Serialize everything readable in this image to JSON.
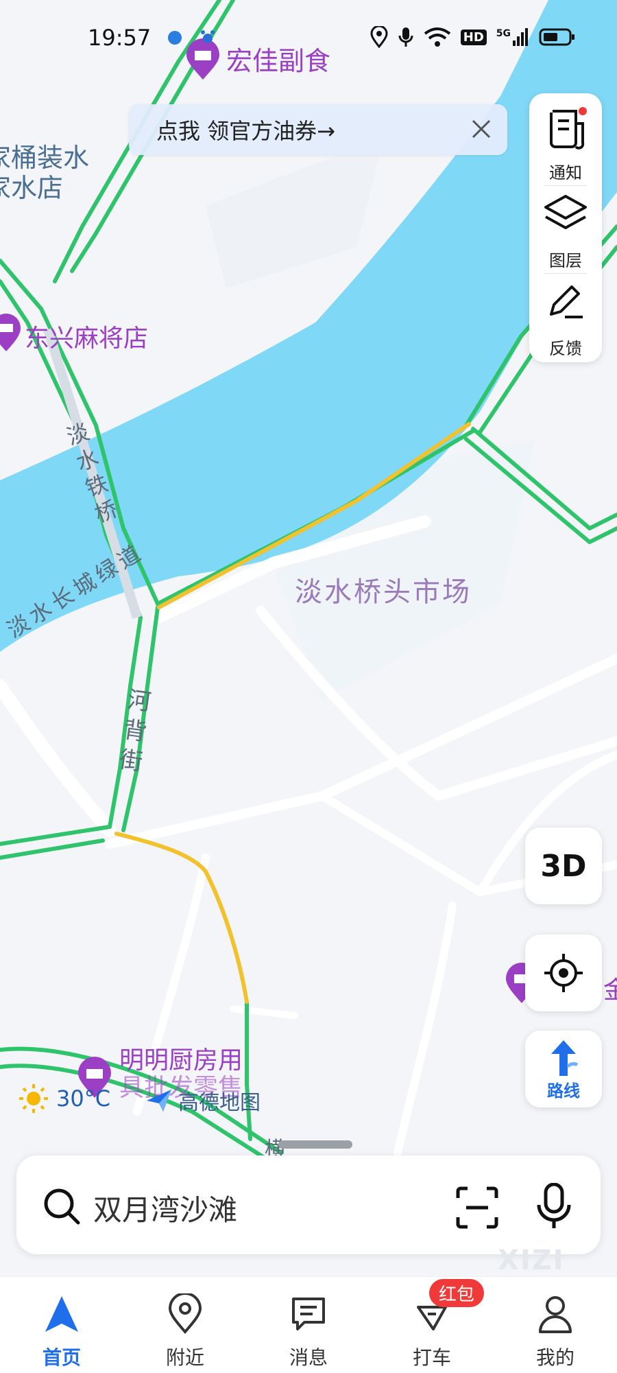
{
  "status_bar": {
    "time": "19:57",
    "network": "5G",
    "hd": "HD"
  },
  "banner": {
    "text": "点我 领官方油券→"
  },
  "side_panel": {
    "notify": "通知",
    "layers": "图层",
    "feedback": "反馈"
  },
  "map": {
    "labels": {
      "shop_hongjia": "宏佳副食",
      "shop_water_line1": "家桶装水",
      "shop_water_line2": "家水店",
      "mahjong": "东兴麻将店",
      "bridge": "淡水铁桥",
      "greenway": "淡水长城绿道",
      "market": "淡水桥头市场",
      "street": "河背街",
      "kitchen_line1": "明明厨房用",
      "kitchen_line2": "具批发零售",
      "bottom_road": "横",
      "right_poi": "金"
    },
    "colors": {
      "water": "#80d8f7",
      "road": "#ffffff",
      "traffic_green": "#2fc46b",
      "traffic_yellow": "#f2c22e",
      "poi_purple": "#9b3fc4"
    }
  },
  "controls": {
    "three_d": "3D",
    "route": "路线"
  },
  "weather": {
    "temp": "30°C"
  },
  "brand": {
    "name": "高德地图"
  },
  "search": {
    "placeholder": "双月湾沙滩"
  },
  "watermark": "XIZI",
  "tabs": [
    {
      "label": "首页",
      "icon": "home-arrow-icon",
      "active": true
    },
    {
      "label": "附近",
      "icon": "location-pin-icon",
      "active": false
    },
    {
      "label": "消息",
      "icon": "message-icon",
      "active": false
    },
    {
      "label": "打车",
      "icon": "taxi-icon",
      "active": false
    },
    {
      "label": "我的",
      "icon": "user-icon",
      "active": false
    }
  ],
  "taxi_badge": "红包"
}
